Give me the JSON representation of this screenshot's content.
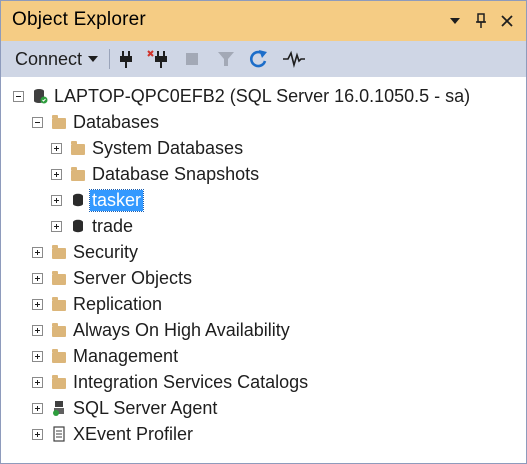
{
  "window": {
    "title": "Object Explorer",
    "accent_color": "#f5cc84",
    "toolbar_color": "#cfd6e5",
    "selection_color": "#3399ff"
  },
  "toolbar": {
    "connect_label": "Connect",
    "icons": [
      "connect-plug-icon",
      "disconnect-plug-icon",
      "stop-icon",
      "filter-icon",
      "refresh-icon",
      "activity-monitor-icon"
    ]
  },
  "tree": {
    "server": "LAPTOP-QPC0EFB2 (SQL Server 16.0.1050.5 - sa)",
    "databases": "Databases",
    "system_databases": "System Databases",
    "database_snapshots": "Database Snapshots",
    "db_tasker": "tasker",
    "db_trade": "trade",
    "security": "Security",
    "server_objects": "Server Objects",
    "replication": "Replication",
    "always_on": "Always On High Availability",
    "management": "Management",
    "integration_services": "Integration Services Catalogs",
    "sql_server_agent": "SQL Server Agent",
    "xevent_profiler": "XEvent Profiler",
    "selected_item": "tasker"
  }
}
